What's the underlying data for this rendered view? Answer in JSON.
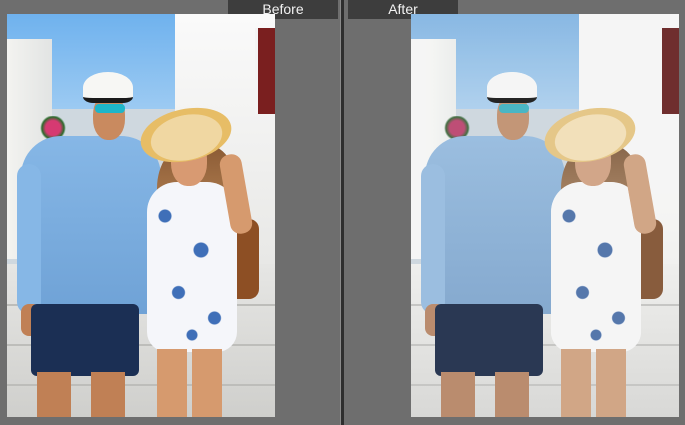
{
  "labels": {
    "before": "Before",
    "after": "After"
  },
  "panels": [
    {
      "id": "before",
      "icon": "photo-before"
    },
    {
      "id": "after",
      "icon": "photo-after"
    }
  ],
  "colors": {
    "background": "#6e6e6e",
    "label_bg": "#3d3d3d",
    "label_text": "#f2f2f2",
    "divider": "#2e2e2e"
  }
}
